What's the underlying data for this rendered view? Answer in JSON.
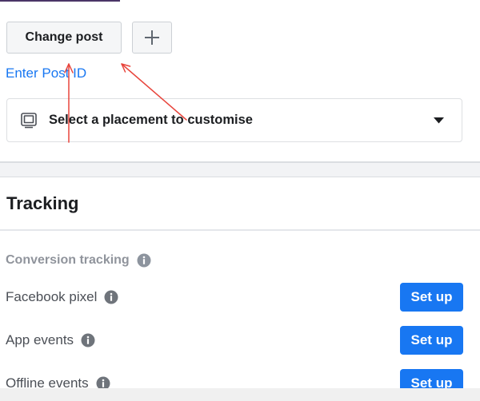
{
  "post": {
    "change_label": "Change post",
    "add_icon": "plus-icon",
    "enter_id_label": "Enter Post ID"
  },
  "placement": {
    "icon": "monitor-icon",
    "value": "Select a placement to customise",
    "caret_icon": "caret-down-icon"
  },
  "tracking": {
    "title": "Tracking",
    "conversion": {
      "label": "Conversion tracking",
      "icon": "info-icon"
    },
    "rows": [
      {
        "label": "Facebook pixel",
        "icon": "info-icon",
        "button": "Set up"
      },
      {
        "label": "App events",
        "icon": "info-icon",
        "button": "Set up"
      },
      {
        "label": "Offline events",
        "icon": "info-icon",
        "button": "Set up"
      }
    ]
  },
  "colors": {
    "link": "#1877f2",
    "primary_button": "#1877f2",
    "muted_text": "#90949c",
    "annotation_arrow": "#e8453c"
  }
}
